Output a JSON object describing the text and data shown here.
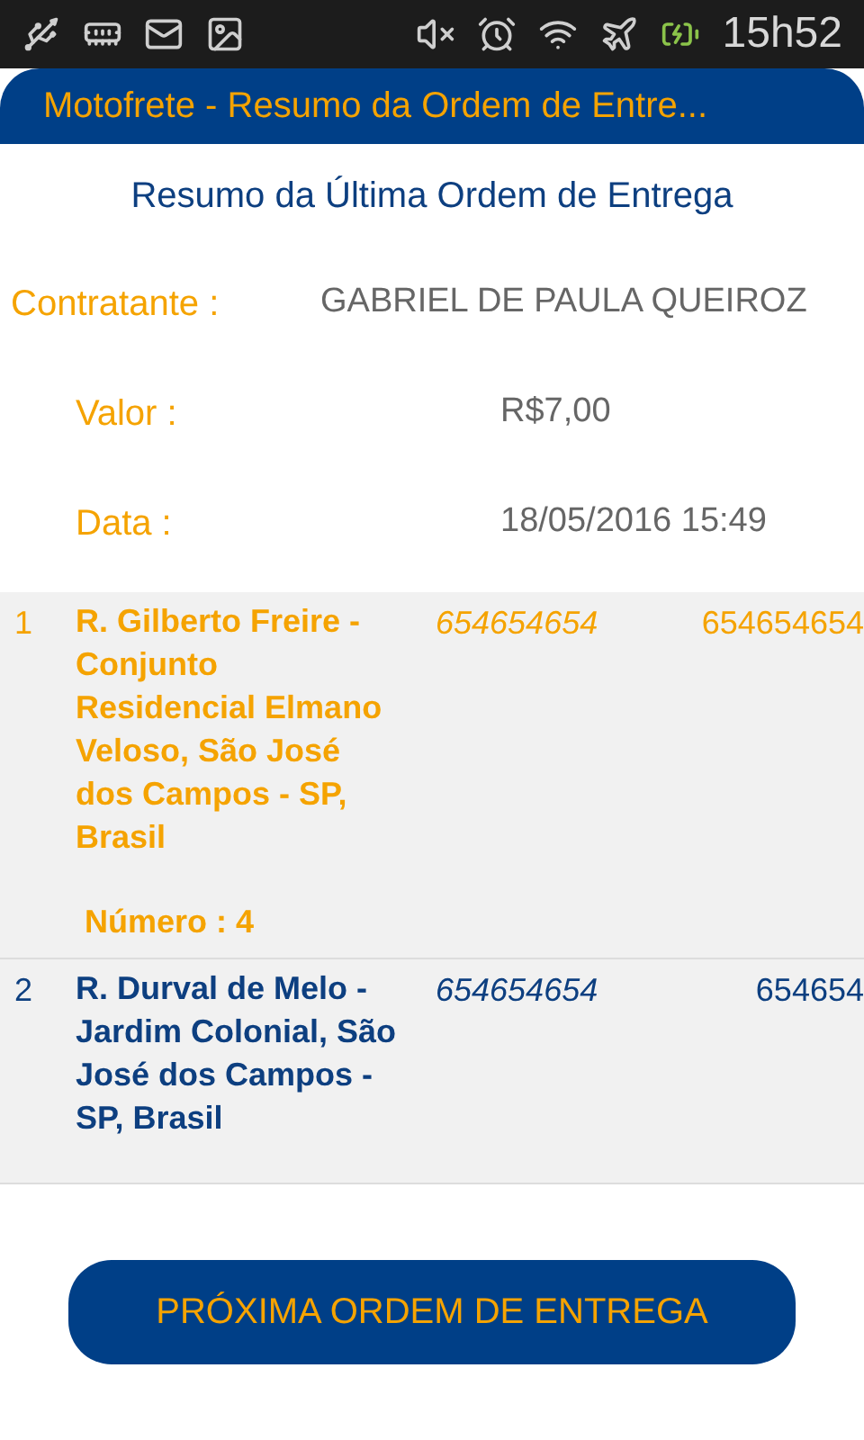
{
  "status_bar": {
    "time": "15h52"
  },
  "app_bar": {
    "title": "Motofrete - Resumo da Ordem de Entre..."
  },
  "heading": "Resumo da Última Ordem de Entrega",
  "fields": [
    {
      "label": "Contratante :",
      "value": "GABRIEL DE PAULA QUEIROZ"
    },
    {
      "label": "Valor :",
      "value": "R$7,00"
    },
    {
      "label": "Data :",
      "value": "18/05/2016 15:49"
    }
  ],
  "deliveries": [
    {
      "index": "1",
      "address": "R. Gilberto Freire - Conjunto Residencial Elmano Veloso, São José dos Campos - SP, Brasil",
      "column_3": "654654654",
      "column_4": "654654654",
      "number": "Número : 4",
      "selected": true
    },
    {
      "index": "2",
      "address": "R. Durval de Melo - Jardim Colonial, São José dos Campos - SP, Brasil",
      "column_3": "654654654",
      "column_4": "654654",
      "selected": false
    }
  ],
  "button": "PRÓXIMA ORDEM DE ENTREGA"
}
